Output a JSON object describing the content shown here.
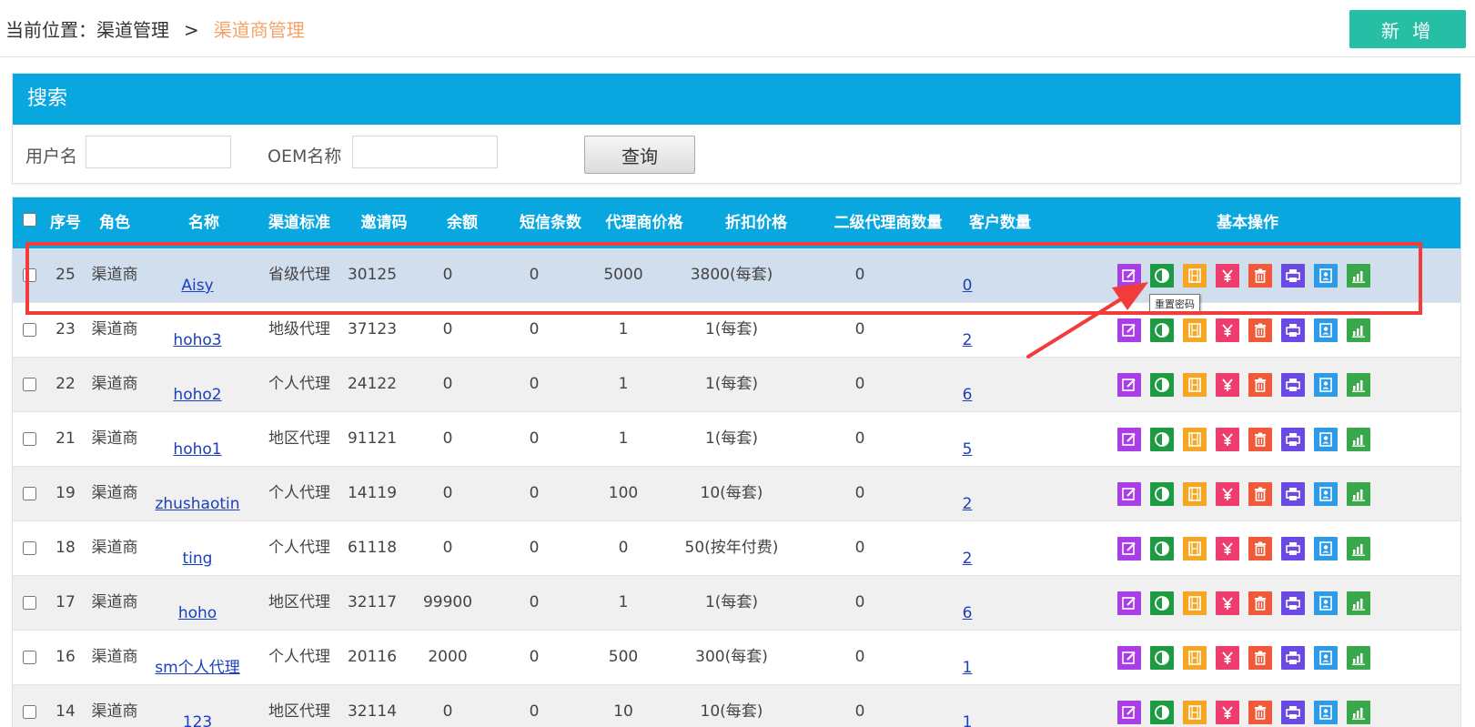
{
  "breadcrumb": {
    "prefix": "当前位置：",
    "parent": "渠道管理",
    "separator": ">",
    "current": "渠道商管理"
  },
  "add_button": "新 增",
  "search": {
    "title": "搜索",
    "username_label": "用户名",
    "username_value": "",
    "oem_label": "OEM名称",
    "oem_value": "",
    "query_button": "查询"
  },
  "table": {
    "headers": {
      "seq": "序号",
      "role": "角色",
      "name": "名称",
      "standard": "渠道标准",
      "invite": "邀请码",
      "balance": "余额",
      "sms": "短信条数",
      "agent_price": "代理商价格",
      "discount": "折扣价格",
      "sub_agents": "二级代理商数量",
      "customers": "客户数量",
      "ops": "基本操作"
    },
    "rows": [
      {
        "seq": "25",
        "role": "渠道商",
        "name": "Aisy",
        "standard": "省级代理",
        "invite": "30125",
        "balance": "0",
        "sms": "0",
        "agent_price": "5000",
        "discount": "3800(每套)",
        "sub_agents": "0",
        "customers": "0"
      },
      {
        "seq": "23",
        "role": "渠道商",
        "name": "hoho3",
        "standard": "地级代理",
        "invite": "37123",
        "balance": "0",
        "sms": "0",
        "agent_price": "1",
        "discount": "1(每套)",
        "sub_agents": "0",
        "customers": "2"
      },
      {
        "seq": "22",
        "role": "渠道商",
        "name": "hoho2",
        "standard": "个人代理",
        "invite": "24122",
        "balance": "0",
        "sms": "0",
        "agent_price": "1",
        "discount": "1(每套)",
        "sub_agents": "0",
        "customers": "6"
      },
      {
        "seq": "21",
        "role": "渠道商",
        "name": "hoho1",
        "standard": "地区代理",
        "invite": "91121",
        "balance": "0",
        "sms": "0",
        "agent_price": "1",
        "discount": "1(每套)",
        "sub_agents": "0",
        "customers": "5"
      },
      {
        "seq": "19",
        "role": "渠道商",
        "name": "zhushaotin",
        "standard": "个人代理",
        "invite": "14119",
        "balance": "0",
        "sms": "0",
        "agent_price": "100",
        "discount": "10(每套)",
        "sub_agents": "0",
        "customers": "2"
      },
      {
        "seq": "18",
        "role": "渠道商",
        "name": "ting",
        "standard": "个人代理",
        "invite": "61118",
        "balance": "0",
        "sms": "0",
        "agent_price": "0",
        "discount": "50(按年付费)",
        "sub_agents": "0",
        "customers": "2"
      },
      {
        "seq": "17",
        "role": "渠道商",
        "name": "hoho",
        "standard": "地区代理",
        "invite": "32117",
        "balance": "99900",
        "sms": "0",
        "agent_price": "1",
        "discount": "1(每套)",
        "sub_agents": "0",
        "customers": "6"
      },
      {
        "seq": "16",
        "role": "渠道商",
        "name": "sm个人代理",
        "standard": "个人代理",
        "invite": "20116",
        "balance": "2000",
        "sms": "0",
        "agent_price": "500",
        "discount": "300(每套)",
        "sub_agents": "0",
        "customers": "1"
      },
      {
        "seq": "14",
        "role": "渠道商",
        "name": "123",
        "standard": "地区代理",
        "invite": "32114",
        "balance": "0",
        "sms": "0",
        "agent_price": "10",
        "discount": "10(每套)",
        "sub_agents": "0",
        "customers": "1"
      }
    ]
  },
  "operation_icons": [
    {
      "key": "edit",
      "icon": "edit-icon",
      "color": "#a73ee6"
    },
    {
      "key": "reset",
      "icon": "reset-password-icon",
      "color": "#1f9a44"
    },
    {
      "key": "film",
      "icon": "film-icon",
      "color": "#f5a623"
    },
    {
      "key": "yen",
      "icon": "yen-icon",
      "color": "#ee3d6d"
    },
    {
      "key": "delete",
      "icon": "trash-icon",
      "color": "#f05a3b"
    },
    {
      "key": "print",
      "icon": "print-icon",
      "color": "#6b49e3"
    },
    {
      "key": "contact",
      "icon": "contact-icon",
      "color": "#2e9be8"
    },
    {
      "key": "chart",
      "icon": "bar-chart-icon",
      "color": "#39a84a"
    }
  ],
  "tooltip": "重置密码",
  "colors": {
    "header_blue": "#09a7e0",
    "add_button": "#26bfa6",
    "breadcrumb_current": "#f5a36b",
    "selected_row": "#d1deed",
    "annotation_red": "#f23c3c"
  }
}
